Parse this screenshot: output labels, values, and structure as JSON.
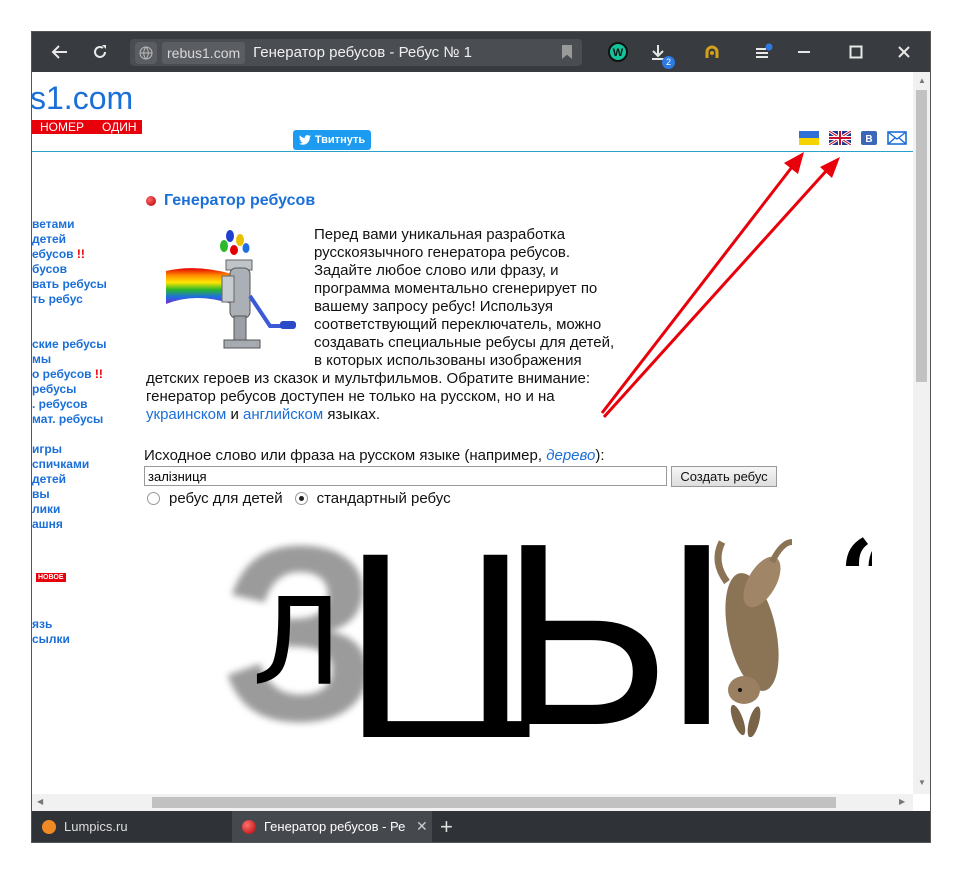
{
  "browser": {
    "address_domain": "rebus1.com",
    "address_title": "Генератор ребусов - Ребус № 1",
    "downloads_count": "2",
    "tabs": [
      {
        "label": "Lumpics.ru",
        "active": false
      },
      {
        "label": "Генератор ребусов - Ре",
        "active": true
      }
    ]
  },
  "site": {
    "logo": "s1.com",
    "logo_bar": [
      "НОМЕР",
      "ОДИН"
    ],
    "tweet_label": "Твитнуть",
    "vk_label": "В"
  },
  "sidebar": {
    "items": [
      "ветами",
      "детей",
      "ебусов",
      "бусов",
      "вать ребусы",
      "ть ребус",
      "ские ребусы",
      "мы",
      "о ребусов",
      "ребусы",
      ". ребусов",
      "мат. ребусы",
      "игры",
      "спичками",
      "детей",
      "вы",
      "лики",
      "ашня",
      "НОВОЕ",
      "язь",
      "сылки"
    ],
    "marks": [
      "!!",
      "!!"
    ]
  },
  "main": {
    "heading": "Генератор ребусов",
    "intro_text": "Перед вами уникальная разработка русскоязычного генератора ребусов. Задайте любое слово или фразу, и программа моментально сгенерирует по вашему запросу ребус! Используя соответствующий переключатель, можно создавать специальные ребусы для детей, в которых использованы изображения детских героев из сказок и мультфильмов. Обратите внимание: генератор ребусов доступен не только на русском, но и на",
    "link_ukr": "украинском",
    "and_word": "и",
    "link_eng": "английском",
    "intro_end": "языках.",
    "form_label": "Исходное слово или фраза на русском языке (например,",
    "form_example": "дерево",
    "form_label_end": "):",
    "input_value": "залізниця",
    "button_label": "Создать ребус",
    "radio_kids": "ребус для детей",
    "radio_standard": "стандартный ребус"
  },
  "rebus": {
    "letters": [
      "З",
      "Л",
      "Ц",
      "Ы"
    ],
    "quote_mark": "“"
  },
  "colors": {
    "accent": "#1a6fd8",
    "red": "#e8000b",
    "annotation_arrow": "#e8000b"
  }
}
